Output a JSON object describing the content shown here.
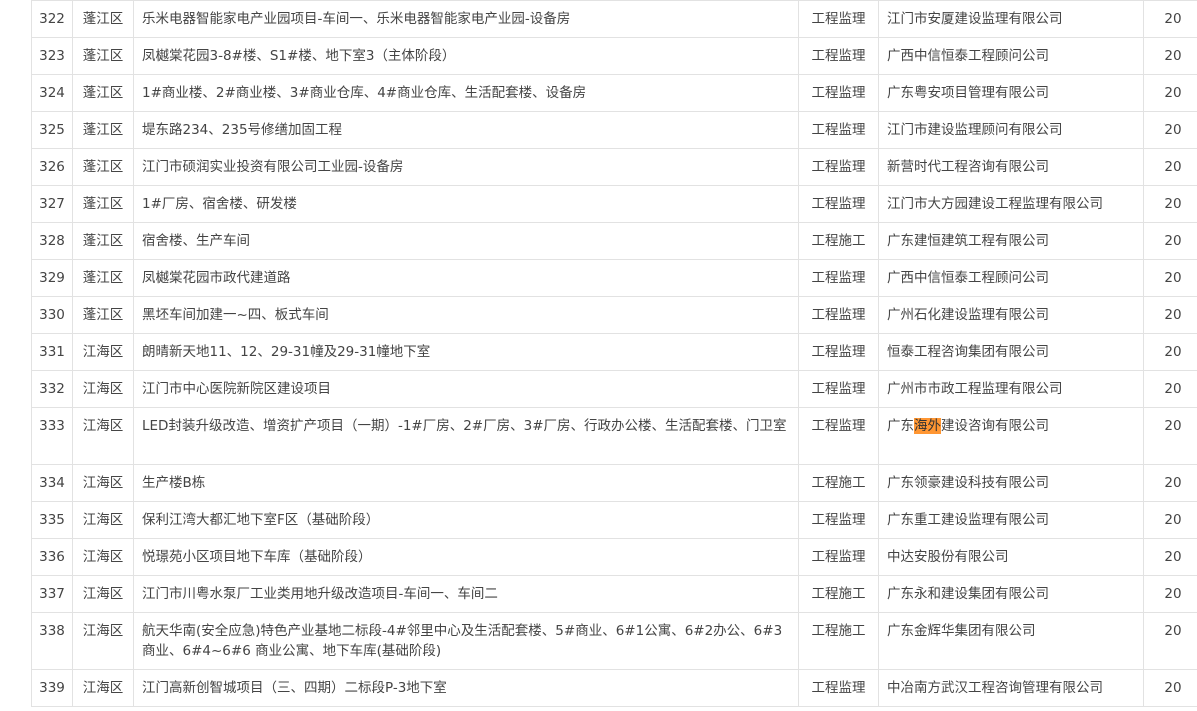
{
  "rows": [
    {
      "no": "322",
      "district": "蓬江区",
      "project": "乐米电器智能家电产业园项目-车间一、乐米电器智能家电产业园-设备房",
      "type": "工程监理",
      "company": "江门市安厦建设监理有限公司",
      "score": "20"
    },
    {
      "no": "323",
      "district": "蓬江区",
      "project": "凤樾棠花园3-8#楼、S1#楼、地下室3（主体阶段）",
      "type": "工程监理",
      "company": "广西中信恒泰工程顾问公司",
      "score": "20"
    },
    {
      "no": "324",
      "district": "蓬江区",
      "project": "1#商业楼、2#商业楼、3#商业仓库、4#商业仓库、生活配套楼、设备房",
      "type": "工程监理",
      "company": "广东粤安项目管理有限公司",
      "score": "20"
    },
    {
      "no": "325",
      "district": "蓬江区",
      "project": "堤东路234、235号修缮加固工程",
      "type": "工程监理",
      "company": "江门市建设监理顾问有限公司",
      "score": "20"
    },
    {
      "no": "326",
      "district": "蓬江区",
      "project": "江门市硕润实业投资有限公司工业园-设备房",
      "type": "工程监理",
      "company": "新营时代工程咨询有限公司",
      "score": "20"
    },
    {
      "no": "327",
      "district": "蓬江区",
      "project": "1#厂房、宿舍楼、研发楼",
      "type": "工程监理",
      "company": "江门市大方园建设工程监理有限公司",
      "score": "20"
    },
    {
      "no": "328",
      "district": "蓬江区",
      "project": "宿舍楼、生产车间",
      "type": "工程施工",
      "company": "广东建恒建筑工程有限公司",
      "score": "20"
    },
    {
      "no": "329",
      "district": "蓬江区",
      "project": "凤樾棠花园市政代建道路",
      "type": "工程监理",
      "company": "广西中信恒泰工程顾问公司",
      "score": "20"
    },
    {
      "no": "330",
      "district": "蓬江区",
      "project": "黑坯车间加建一~四、板式车间",
      "type": "工程监理",
      "company": "广州石化建设监理有限公司",
      "score": "20"
    },
    {
      "no": "331",
      "district": "江海区",
      "project": "朗晴新天地11、12、29-31幢及29-31幢地下室",
      "type": "工程监理",
      "company": "恒泰工程咨询集团有限公司",
      "score": "20"
    },
    {
      "no": "332",
      "district": "江海区",
      "project": "江门市中心医院新院区建设项目",
      "type": "工程监理",
      "company": "广州市市政工程监理有限公司",
      "score": "20"
    },
    {
      "no": "333",
      "district": "江海区",
      "project": "LED封装升级改造、增资扩产项目（一期）-1#厂房、2#厂房、3#厂房、行政办公楼、生活配套楼、门卫室",
      "type": "工程监理",
      "company_pre": "广东",
      "company_hl": "海外",
      "company_post": "建设咨询有限公司",
      "score": "20",
      "tall": true
    },
    {
      "no": "334",
      "district": "江海区",
      "project": "生产楼B栋",
      "type": "工程施工",
      "company": "广东领豪建设科技有限公司",
      "score": "20"
    },
    {
      "no": "335",
      "district": "江海区",
      "project": "保利江湾大都汇地下室F区（基础阶段）",
      "type": "工程监理",
      "company": "广东重工建设监理有限公司",
      "score": "20"
    },
    {
      "no": "336",
      "district": "江海区",
      "project": "悦璟苑小区项目地下车库（基础阶段）",
      "type": "工程监理",
      "company": "中达安股份有限公司",
      "score": "20"
    },
    {
      "no": "337",
      "district": "江海区",
      "project": "江门市川粤水泵厂工业类用地升级改造项目-车间一、车间二",
      "type": "工程施工",
      "company": "广东永和建设集团有限公司",
      "score": "20"
    },
    {
      "no": "338",
      "district": "江海区",
      "project": "航天华南(安全应急)特色产业基地二标段-4#邻里中心及生活配套楼、5#商业、6#1公寓、6#2办公、6#3商业、6#4~6#6 商业公寓、地下车库(基础阶段)",
      "type": "工程施工",
      "company": "广东金辉华集团有限公司",
      "score": "20",
      "tall": true
    },
    {
      "no": "339",
      "district": "江海区",
      "project": "江门高新创智城项目（三、四期）二标段P-3地下室",
      "type": "工程监理",
      "company": "中冶南方武汉工程咨询管理有限公司",
      "score": "20"
    }
  ]
}
